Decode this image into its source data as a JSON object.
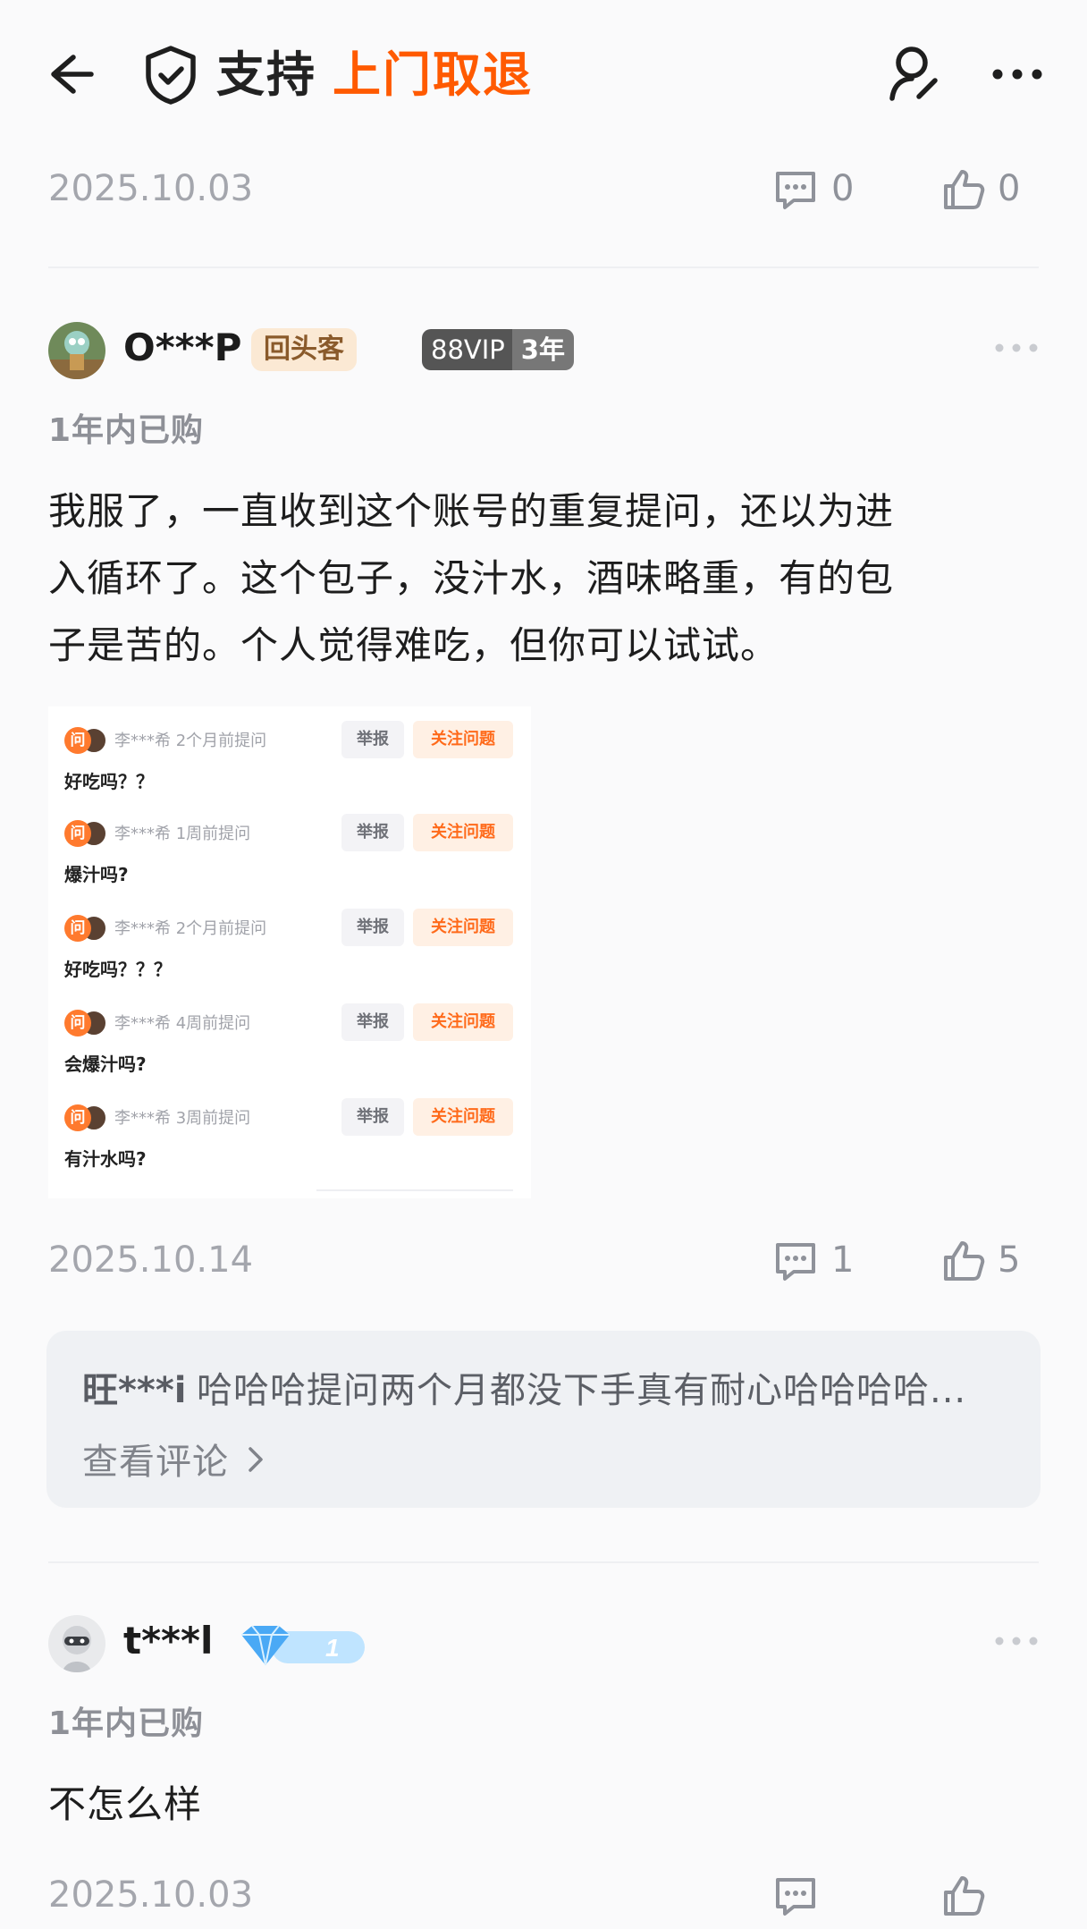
{
  "header": {
    "title_support": "支持",
    "title_feature": "上门取退"
  },
  "top_meta": {
    "date": "2025.10.03",
    "comment_count": "0",
    "like_count": "0"
  },
  "review1": {
    "username": "O***P",
    "badge_regular": "回头客",
    "badge_vip": "88VIP",
    "badge_vip_years": "3年",
    "purchase": "1年内已购",
    "text_line1": "我服了，一直收到这个账号的重复提问，还以为进",
    "text_line2": "入循环了。这个包子，没汁水，酒味略重，有的包",
    "text_line3": "子是苦的。个人觉得难吃，但你可以试试。",
    "qa": [
      {
        "ask_tag": "问",
        "user": "李***希 2个月前提问",
        "report": "举报",
        "follow": "关注问题",
        "question": "好吃吗？？"
      },
      {
        "ask_tag": "问",
        "user": "李***希 1周前提问",
        "report": "举报",
        "follow": "关注问题",
        "question": "爆汁吗?"
      },
      {
        "ask_tag": "问",
        "user": "李***希 2个月前提问",
        "report": "举报",
        "follow": "关注问题",
        "question": "好吃吗？？？"
      },
      {
        "ask_tag": "问",
        "user": "李***希 4周前提问",
        "report": "举报",
        "follow": "关注问题",
        "question": "会爆汁吗?"
      },
      {
        "ask_tag": "问",
        "user": "李***希 3周前提问",
        "report": "举报",
        "follow": "关注问题",
        "question": "有汁水吗?"
      }
    ],
    "date": "2025.10.14",
    "comment_count": "1",
    "like_count": "5",
    "reply": {
      "user": "旺***i",
      "text": "哈哈哈提问两个月都没下手真有耐心哈哈哈哈...",
      "link": "查看评论"
    }
  },
  "review2": {
    "username": "t***l",
    "level": "1",
    "purchase": "1年内已购",
    "text": "不怎么样",
    "date": "2025.10.03"
  },
  "colors": {
    "accent": "#ff5a00",
    "muted": "#a4a6ad",
    "badge_bg": "#fbe9d4"
  }
}
